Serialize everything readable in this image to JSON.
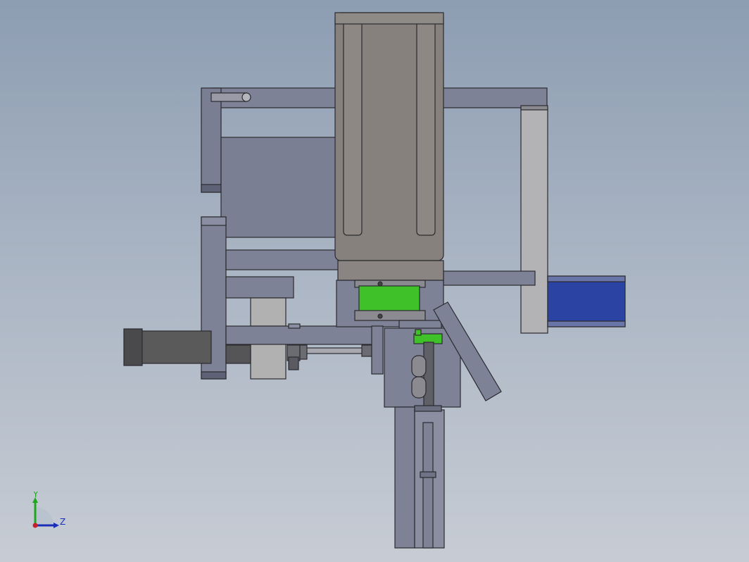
{
  "viewport": {
    "background_top": "#8d9db2",
    "background_bottom": "#c7ccd4"
  },
  "model": {
    "colors": {
      "frame": "#7e8297",
      "frame_dark": "#5e6276",
      "motor_body": "#86817d",
      "light_grey": "#b1b1b1",
      "blue_block": "#2b43a3",
      "green_part": "#3fc12a",
      "outline": "#2a2a2e"
    }
  },
  "triad": {
    "y_label": "Y",
    "z_label": "Z",
    "y_color": "#1fa61f",
    "z_color": "#1b2eb8",
    "origin_color": "#c8202a"
  }
}
